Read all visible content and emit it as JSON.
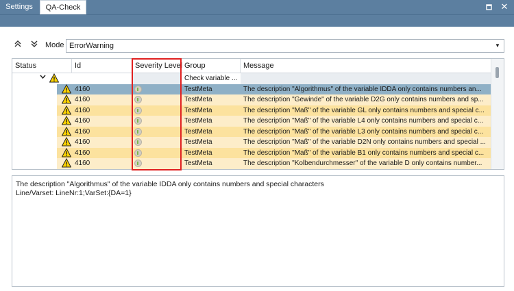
{
  "tabs": [
    {
      "label": "Settings",
      "active": false
    },
    {
      "label": "QA-Check",
      "active": true
    }
  ],
  "window_buttons": {
    "restore": "restore-icon",
    "close": "close-icon"
  },
  "toolbar": {
    "expand_all_icon": "double-chevron-up-icon",
    "collapse_all_icon": "double-chevron-down-icon",
    "mode_label": "Mode",
    "mode_value": "ErrorWarning"
  },
  "grid": {
    "columns": [
      "Status",
      "Id",
      "Severity Level",
      "Group",
      "Message"
    ],
    "group_row": {
      "label": "Check variable ..."
    },
    "rows": [
      {
        "id": "4160",
        "group": "TestMeta",
        "message": "The description \"Algorithmus\" of the variable IDDA only contains numbers an...",
        "selected": true
      },
      {
        "id": "4160",
        "group": "TestMeta",
        "message": "The description \"Gewinde\" of the variable D2G only contains numbers and sp...",
        "selected": false
      },
      {
        "id": "4160",
        "group": "TestMeta",
        "message": "The description \"Maß\" of the variable GL only contains numbers and special c...",
        "selected": false
      },
      {
        "id": "4160",
        "group": "TestMeta",
        "message": "The description \"Maß\" of the variable L4 only contains numbers and special c...",
        "selected": false
      },
      {
        "id": "4160",
        "group": "TestMeta",
        "message": "The description \"Maß\" of the variable L3 only contains numbers and special c...",
        "selected": false
      },
      {
        "id": "4160",
        "group": "TestMeta",
        "message": "The description \"Maß\" of the variable D2N only contains numbers and special ...",
        "selected": false
      },
      {
        "id": "4160",
        "group": "TestMeta",
        "message": "The description \"Maß\" of the variable B1 only contains numbers and special c...",
        "selected": false
      },
      {
        "id": "4160",
        "group": "TestMeta",
        "message": "The description \"Kolbendurchmesser\" of the variable D only contains number...",
        "selected": false
      }
    ]
  },
  "details": {
    "line1": "The description \"Algorithmus\" of the variable IDDA only contains numbers and special characters",
    "line2": "Line/Varset: LineNr:1;VarSet:{DA=1}"
  },
  "colors": {
    "header_blue": "#5c7fa0",
    "selected_row": "#8fb0c6",
    "row_even": "#fdedc9",
    "row_odd": "#fce29e",
    "highlight": "#e02020"
  }
}
